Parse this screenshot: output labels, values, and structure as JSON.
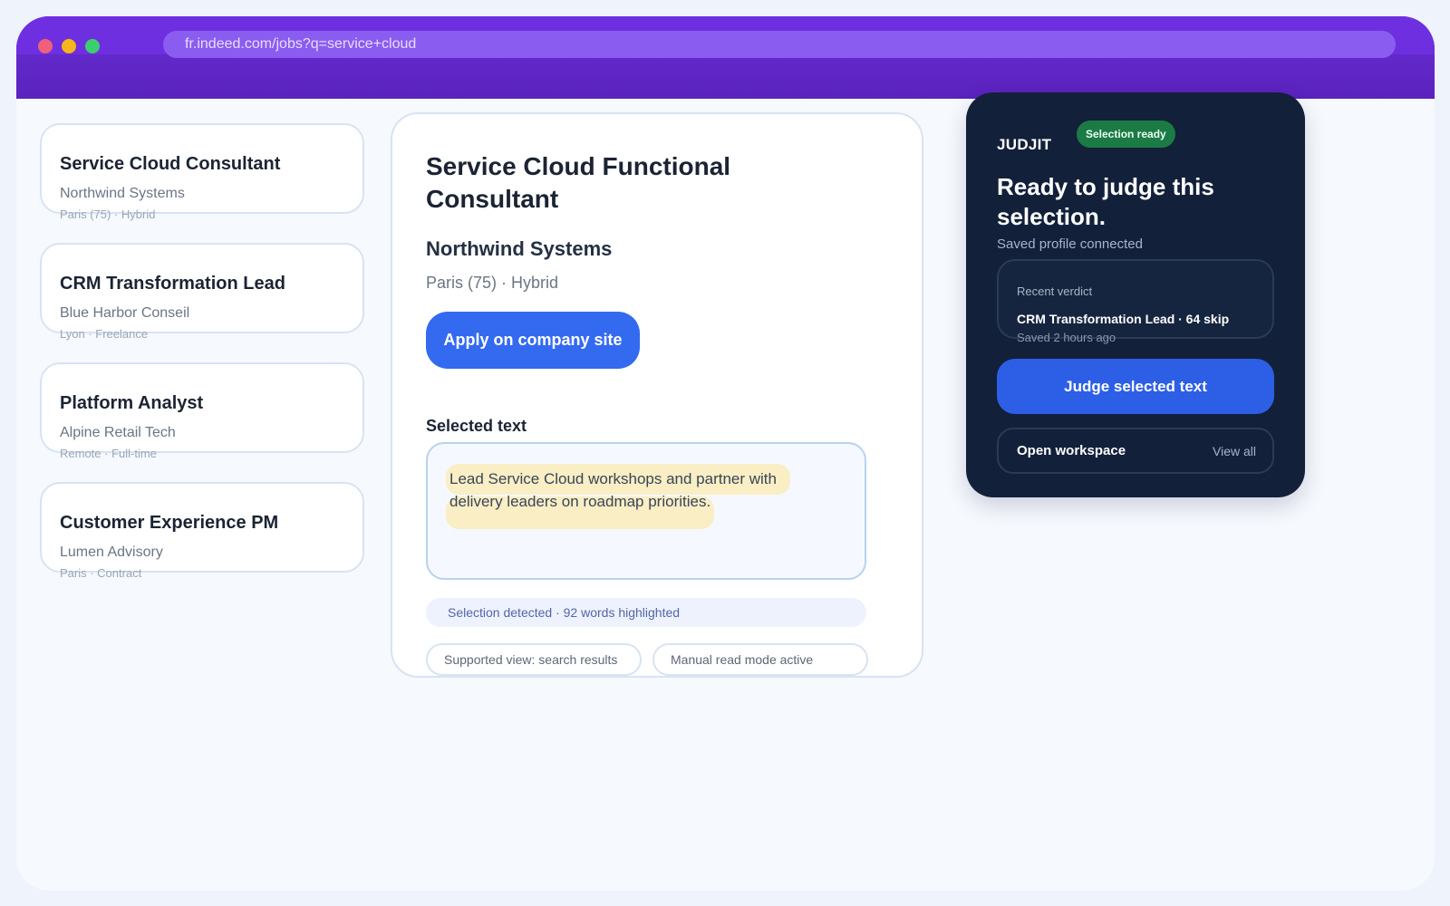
{
  "browser": {
    "url": "fr.indeed.com/jobs?q=service+cloud"
  },
  "job_list": [
    {
      "title": "Service Cloud Consultant",
      "company": "Northwind Systems",
      "meta": "Paris (75) · Hybrid"
    },
    {
      "title": "CRM Transformation Lead",
      "company": "Blue Harbor Conseil",
      "meta": "Lyon · Freelance"
    },
    {
      "title": "Platform Analyst",
      "company": "Alpine Retail Tech",
      "meta": "Remote · Full-time"
    },
    {
      "title": "Customer Experience PM",
      "company": "Lumen Advisory",
      "meta": "Paris · Contract"
    }
  ],
  "detail": {
    "title": "Service Cloud Functional Consultant",
    "company": "Northwind Systems",
    "location": "Paris (75) · Hybrid",
    "apply_label": "Apply on company site",
    "selected_label": "Selected text",
    "selected_text": "Lead Service Cloud workshops and partner with delivery leaders on roadmap priorities.",
    "status": "Selection detected · 92 words highlighted",
    "chips": [
      "Supported view: search results",
      "Manual read mode active"
    ]
  },
  "judjit": {
    "brand": "JUDJIT",
    "badge": "Selection ready",
    "headline": "Ready to judge this selection.",
    "subtitle": "Saved profile connected",
    "recent_label": "Recent verdict",
    "recent_title": "CRM Transformation Lead · 64 skip",
    "recent_time": "Saved 2 hours ago",
    "judge_label": "Judge selected text",
    "workspace_label": "Open workspace",
    "view_all": "View all"
  },
  "colors": {
    "chrome": "#5a22bd",
    "accent": "#336af0",
    "panel": "#12203a",
    "badge": "#1c7a45",
    "highlight": "#f9eec4"
  }
}
